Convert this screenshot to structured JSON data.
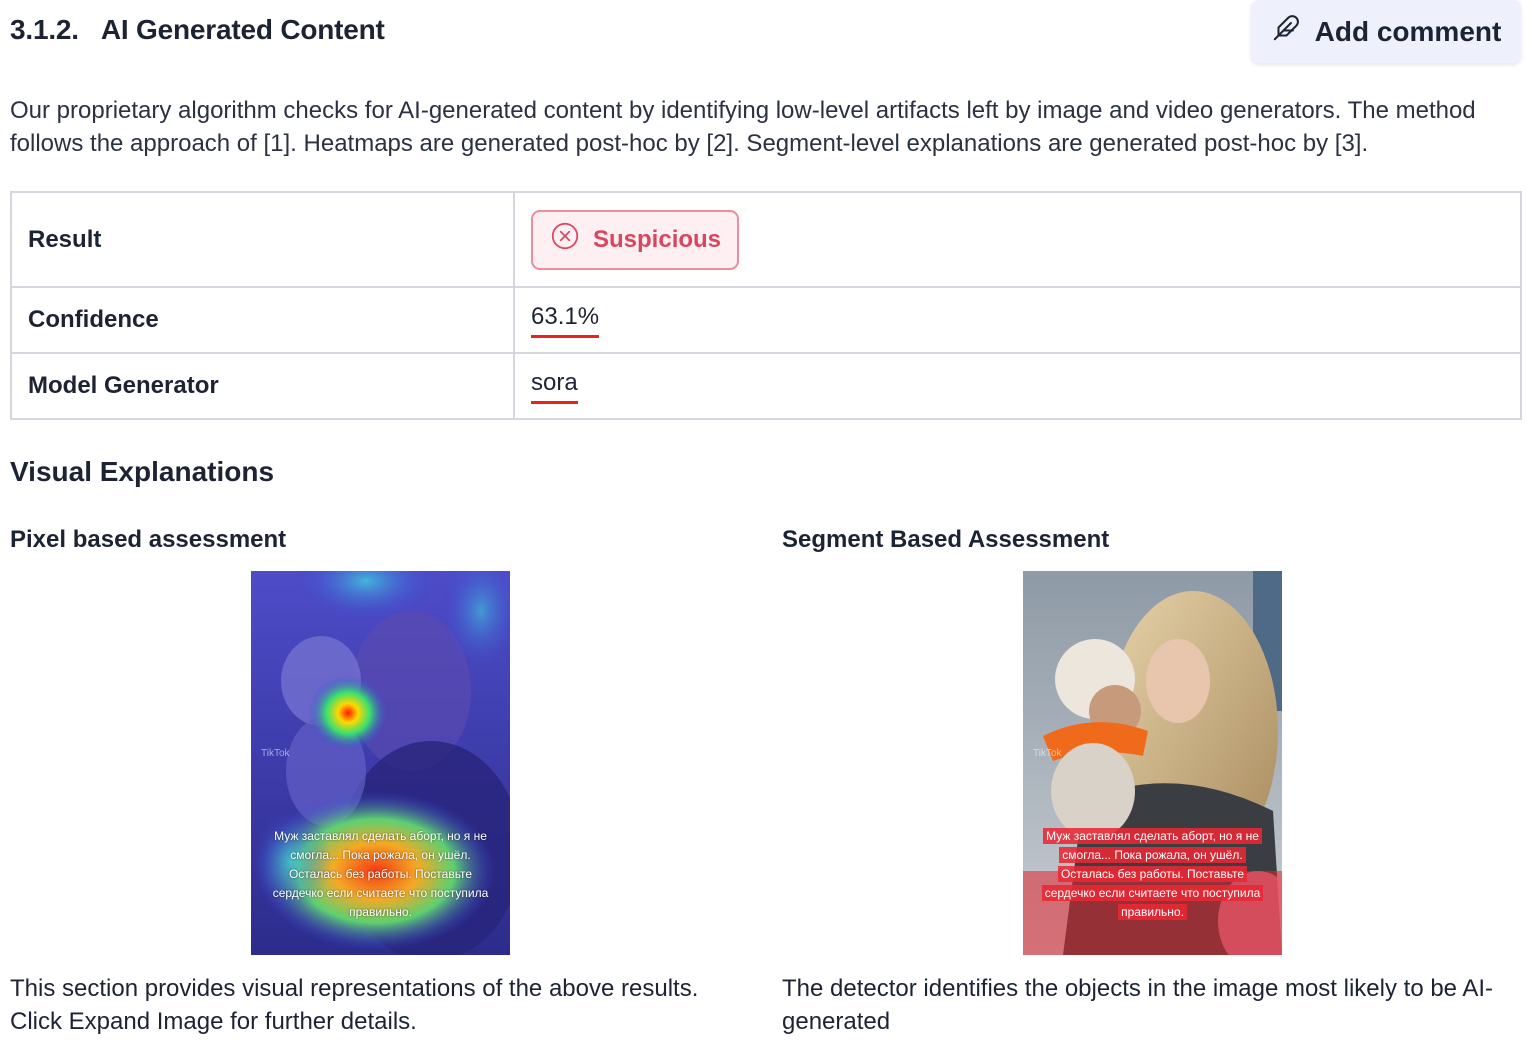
{
  "header": {
    "section_number": "3.1.2.",
    "section_title": "AI Generated Content",
    "add_comment_label": "Add comment"
  },
  "intro": "Our proprietary algorithm checks for AI-generated content by identifying low-level artifacts left by image and video generators. The method follows the approach of [1].  Heatmaps are generated post-hoc by [2].  Segment-level explanations are generated post-hoc by [3].",
  "results": {
    "result_label": "Result",
    "result_value": "Suspicious",
    "confidence_label": "Confidence",
    "confidence_value": "63.1%",
    "model_label": "Model Generator",
    "model_value": "sora"
  },
  "visual": {
    "title": "Visual Explanations",
    "pixel": {
      "title": "Pixel based assessment",
      "caption": "This section provides visual representations of the above results. Click Expand Image for further details.",
      "overlay_text": "Муж заставлял сделать аборт, но я не смогла... Пока рожала, он ушёл. Осталась без работы. Поставьте сердечко если считаете что поступила правильно.",
      "watermark": "TikTok"
    },
    "segment": {
      "title": "Segment Based Assessment",
      "caption": "The detector identifies the objects in the image most likely to be AI-generated",
      "overlay_text": "Муж заставлял сделать аборт, но я не смогла... Пока рожала, он ушёл. Осталась без работы. Поставьте сердечко если считаете что поступила правильно.",
      "watermark": "TikTok"
    }
  },
  "colors": {
    "suspicious": "#d9465e",
    "accent_underline": "#e8231d",
    "button_bg": "#eef0fb"
  },
  "icons": {
    "add_comment": "feather-pen-icon",
    "suspicious": "x-circle-icon"
  }
}
